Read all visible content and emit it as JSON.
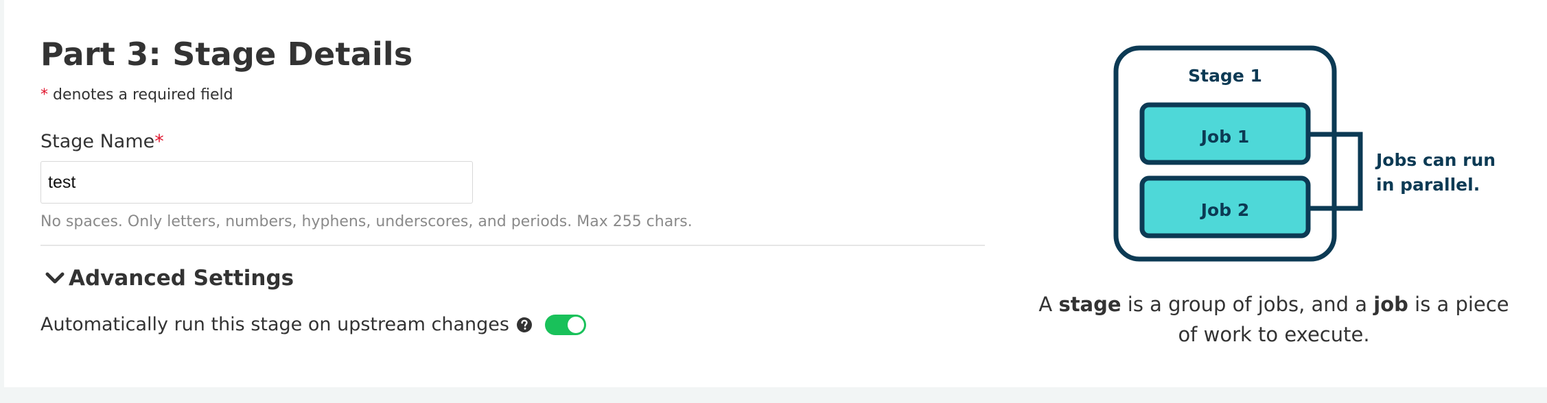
{
  "form": {
    "title": "Part 3: Stage Details",
    "required_star": "*",
    "required_note": " denotes a required field",
    "stage_name": {
      "label": "Stage Name",
      "required_star": "*",
      "value": "test",
      "hint": "No spaces. Only letters, numbers, hyphens, underscores, and periods. Max 255 chars."
    },
    "advanced": {
      "label": "Advanced Settings",
      "icon": "chevron-down-icon",
      "expanded": true
    },
    "auto_run": {
      "label": "Automatically run this stage on upstream changes",
      "help_icon": "question-circle-icon",
      "enabled": true
    }
  },
  "diagram": {
    "stage_label": "Stage 1",
    "job1_label": "Job 1",
    "job2_label": "Job 2",
    "parallel_line1": "Jobs can run",
    "parallel_line2": "in parallel.",
    "colors": {
      "outline": "#0c3a54",
      "job_fill": "#4ed8d8"
    }
  },
  "caption": {
    "part1": "A ",
    "stage_word": "stage",
    "part2": " is a group of jobs, and a ",
    "job_word": "job",
    "part3": " is a piece of work to execute."
  },
  "colors": {
    "required": "#e0152d",
    "toggle_on": "#19c15a",
    "background": "#f2f5f5"
  }
}
